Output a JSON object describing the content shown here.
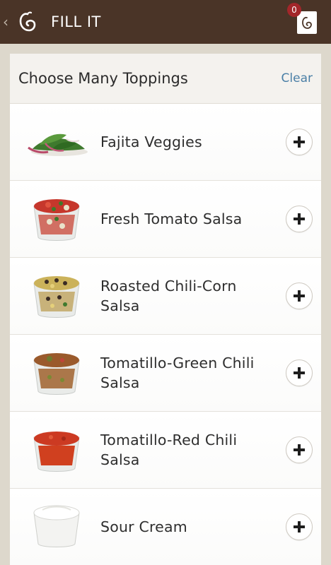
{
  "app": {
    "back_glyph": "‹",
    "title": "FILL IT",
    "cart_count": "0",
    "colors": {
      "header_bg": "#4a3427",
      "badge": "#a3262a",
      "link": "#4a7fa6"
    }
  },
  "panel": {
    "title": "Choose Many Toppings",
    "clear_label": "Clear"
  },
  "items": [
    {
      "label": "Fajita Veggies",
      "image": "fajita-veggies-image"
    },
    {
      "label": "Fresh Tomato Salsa",
      "image": "fresh-tomato-salsa-image"
    },
    {
      "label": "Roasted Chili-Corn Salsa",
      "image": "roasted-chili-corn-salsa-image"
    },
    {
      "label": "Tomatillo-Green Chili Salsa",
      "image": "tomatillo-green-chili-salsa-image"
    },
    {
      "label": "Tomatillo-Red Chili Salsa",
      "image": "tomatillo-red-chili-salsa-image"
    },
    {
      "label": "Sour Cream",
      "image": "sour-cream-image"
    }
  ]
}
